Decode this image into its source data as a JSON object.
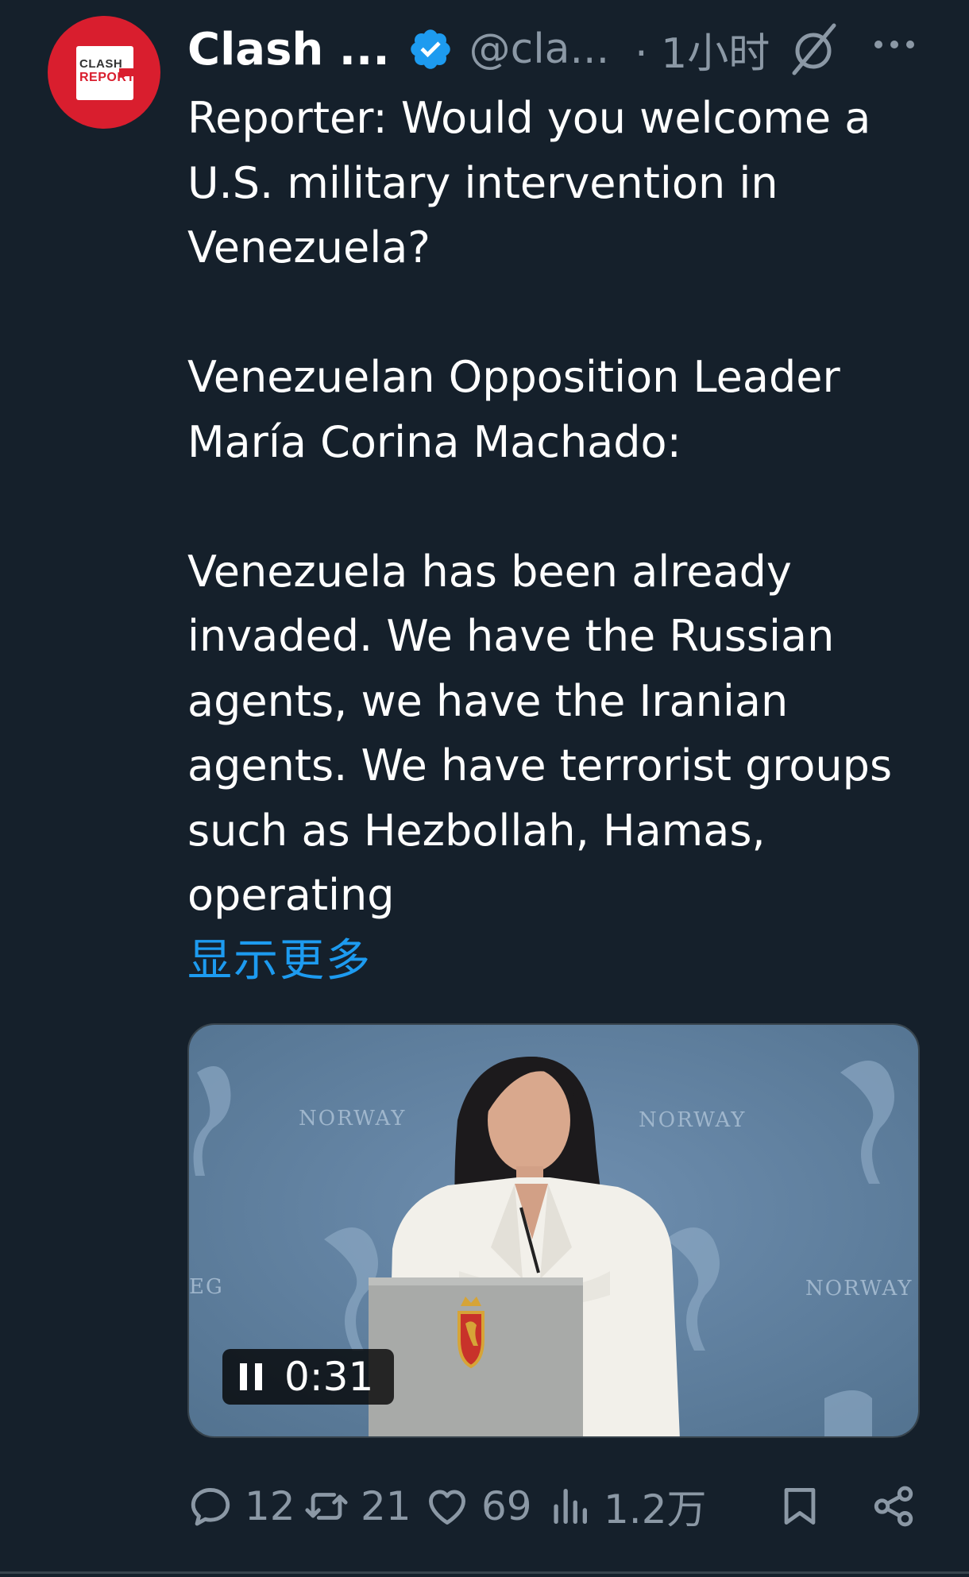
{
  "author": {
    "name": "Clash ...",
    "handle": "@cla...",
    "time": "· 1小时",
    "avatar_text_top": "CLASH",
    "avatar_text_bottom": "REPORT",
    "verified_color": "#1d9bf0",
    "avatar_color": "#d91e2e"
  },
  "tweet": {
    "paragraphs": [
      "Reporter: Would you welcome a U.S. military intervention in Venezuela?",
      "Venezuelan Opposition Leader María Corina Machado:",
      "Venezuela has been already invaded. We have the Russian agents, we have the Iranian agents. We have terrorist groups such as Hezbollah, Hamas, operating"
    ],
    "show_more": "显示更多"
  },
  "media": {
    "type": "video",
    "duration": "0:31",
    "backdrop_text": [
      "NORWAY",
      "NORWAY",
      "NORWAY",
      "EG"
    ]
  },
  "actions": {
    "replies": "12",
    "reposts": "21",
    "likes": "69",
    "views": "1.2万"
  },
  "icons": {
    "verified": "verified-badge-icon",
    "grok": "grok-icon",
    "more": "more-options-icon",
    "reply": "reply-icon",
    "repost": "repost-icon",
    "like": "heart-icon",
    "views": "views-icon",
    "bookmark": "bookmark-icon",
    "share": "share-icon",
    "pause": "pause-icon"
  },
  "colors": {
    "background": "#15202b",
    "text": "#ffffff",
    "secondary": "#8b98a5",
    "link": "#1d9bf0"
  }
}
